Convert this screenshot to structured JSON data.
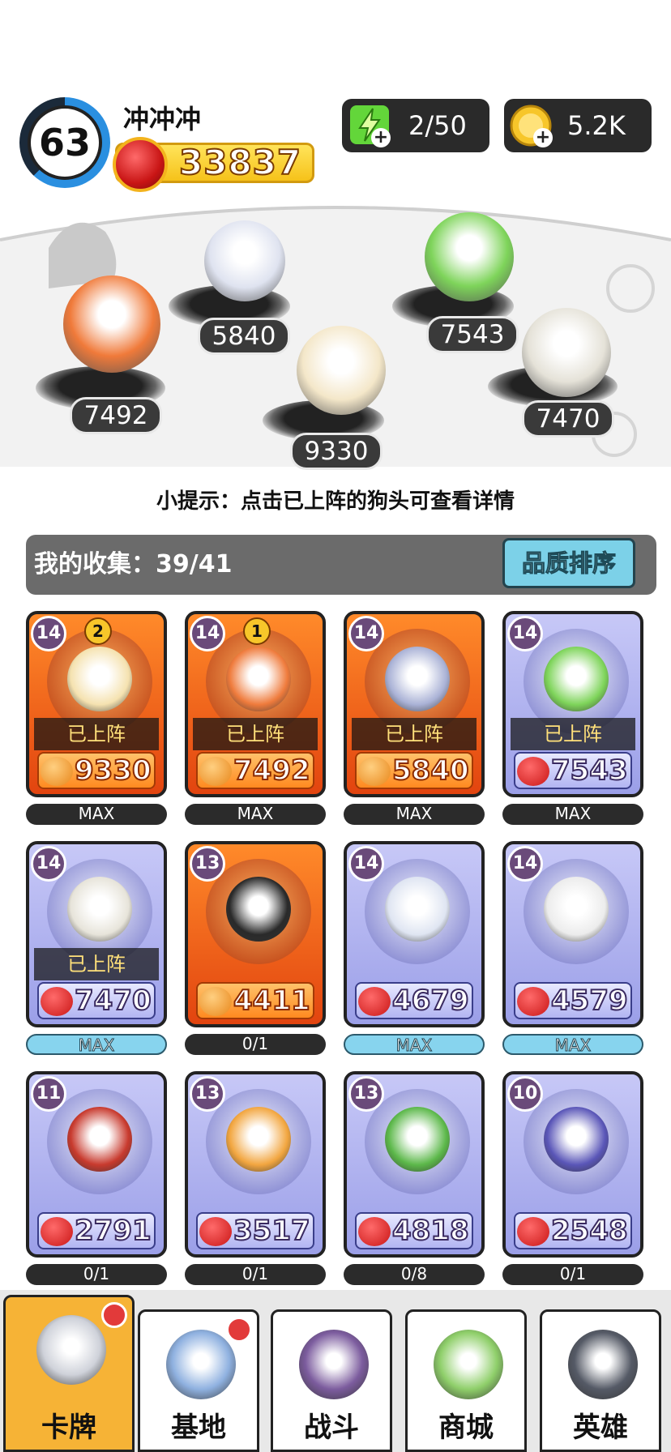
{
  "player": {
    "level": "63",
    "name": "冲冲冲",
    "power": "33837"
  },
  "resources": {
    "energy": "2/50",
    "coins": "5.2K"
  },
  "lineup": [
    {
      "name": "fire-ice-dog",
      "power": "7492",
      "color": "#f07a3a"
    },
    {
      "name": "husky-dog",
      "power": "5840",
      "color": "#dfe3f0"
    },
    {
      "name": "golden-helmet-dog",
      "power": "9330",
      "color": "#f4e7c9"
    },
    {
      "name": "cabbage-dog",
      "power": "7543",
      "color": "#7ed45a"
    },
    {
      "name": "soldier-dog",
      "power": "7470",
      "color": "#e5e2d8"
    }
  ],
  "hint": "小提示：点击已上阵的狗头可查看详情",
  "collection": {
    "label": "我的收集：39/41",
    "sort_label": "品质排序"
  },
  "deployed_label": "已上阵",
  "cards": [
    {
      "level": "14",
      "rank": "2",
      "style": "orange",
      "deployed": true,
      "power": "9330",
      "progress": "MAX",
      "progress_style": "dark",
      "color": "#f5e2b0"
    },
    {
      "level": "14",
      "rank": "1",
      "style": "orange",
      "deployed": true,
      "power": "7492",
      "progress": "MAX",
      "progress_style": "dark",
      "color": "#ef7b3c"
    },
    {
      "level": "14",
      "rank": "",
      "style": "orange",
      "deployed": true,
      "power": "5840",
      "progress": "MAX",
      "progress_style": "dark",
      "color": "#aab2d6"
    },
    {
      "level": "14",
      "rank": "",
      "style": "purple",
      "deployed": true,
      "power": "7543",
      "progress": "MAX",
      "progress_style": "dark",
      "color": "#7ed45a"
    },
    {
      "level": "14",
      "rank": "",
      "style": "purple",
      "deployed": true,
      "power": "7470",
      "progress": "MAX",
      "progress_style": "blue",
      "color": "#e7e4da"
    },
    {
      "level": "13",
      "rank": "",
      "style": "orange",
      "deployed": false,
      "power": "4411",
      "progress": "0/1",
      "progress_style": "dark",
      "color": "#2a2a2a"
    },
    {
      "level": "14",
      "rank": "",
      "style": "purple",
      "deployed": false,
      "power": "4679",
      "progress": "MAX",
      "progress_style": "blue",
      "color": "#dfe5f2"
    },
    {
      "level": "14",
      "rank": "",
      "style": "purple",
      "deployed": false,
      "power": "4579",
      "progress": "MAX",
      "progress_style": "blue",
      "color": "#ececec"
    },
    {
      "level": "11",
      "rank": "",
      "style": "purple",
      "deployed": false,
      "power": "2791",
      "progress": "0/1",
      "progress_style": "dark",
      "color": "#c83a2e"
    },
    {
      "level": "13",
      "rank": "",
      "style": "purple",
      "deployed": false,
      "power": "3517",
      "progress": "0/1",
      "progress_style": "dark",
      "color": "#f2a640"
    },
    {
      "level": "13",
      "rank": "",
      "style": "purple",
      "deployed": false,
      "power": "4818",
      "progress": "0/8",
      "progress_style": "dark",
      "color": "#5cb84a"
    },
    {
      "level": "10",
      "rank": "",
      "style": "purple",
      "deployed": false,
      "power": "2548",
      "progress": "0/1",
      "progress_style": "dark",
      "color": "#5a56b8"
    }
  ],
  "tabs": [
    {
      "label": "卡牌",
      "icon": "dog-card-icon",
      "active": true,
      "badge": true,
      "color": "#cfd2da"
    },
    {
      "label": "基地",
      "icon": "castle-icon",
      "active": false,
      "badge": true,
      "color": "#8fb1e0"
    },
    {
      "label": "战斗",
      "icon": "paw-icon",
      "active": false,
      "badge": false,
      "color": "#7c5c9e"
    },
    {
      "label": "商城",
      "icon": "money-icon",
      "active": false,
      "badge": false,
      "color": "#8fcf6a"
    },
    {
      "label": "英雄",
      "icon": "hero-dog-icon",
      "active": false,
      "badge": false,
      "color": "#555a66"
    }
  ]
}
